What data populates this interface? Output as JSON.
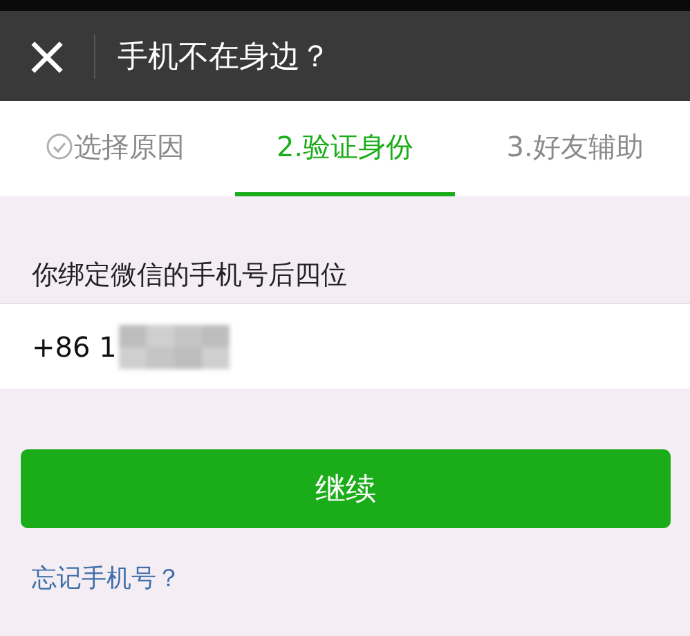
{
  "title_bar": {
    "close_icon": "×",
    "title": "手机不在身边？"
  },
  "tabs": [
    {
      "label": "选择原因",
      "selected": false,
      "completed": true
    },
    {
      "label": "2.验证身份",
      "selected": true,
      "completed": false
    },
    {
      "label": "3.好友辅助",
      "selected": false,
      "completed": false
    }
  ],
  "form": {
    "label": "你绑定微信的手机号后四位",
    "value": "+86 1"
  },
  "continue_button": "继续",
  "forgot_link": "忘记手机号？"
}
